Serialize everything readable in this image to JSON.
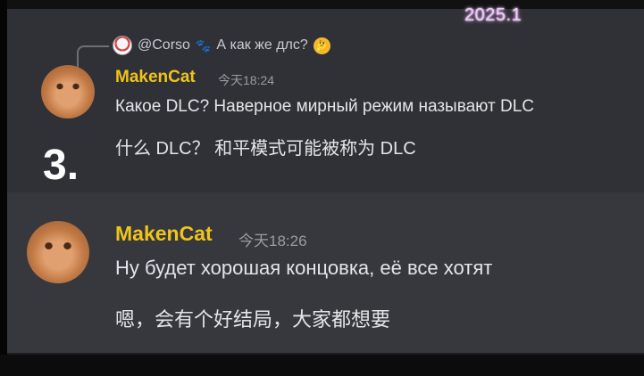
{
  "overlay": {
    "stamp": "2025.1",
    "number": "3."
  },
  "reply": {
    "author": "@Corso",
    "text": "А как же длс?",
    "paw_icon": "paw-icon",
    "emoji_icon": "thinking-face-icon"
  },
  "messages": [
    {
      "author": "MakenCat",
      "timestamp": "今天18:24",
      "lines": [
        "Какое DLC? Наверное мирный режим называют DLC",
        "什么 DLC？ 和平模式可能被称为 DLC"
      ]
    },
    {
      "author": "MakenCat",
      "timestamp": "今天18:26",
      "lines": [
        "Ну будет хорошая концовка, её все хотят",
        "嗯，会有个好结局，大家都想要"
      ]
    }
  ],
  "colors": {
    "author": "#f0c419",
    "panel_top": "#303136",
    "panel_bottom": "#36383d",
    "text": "#e4e5e8",
    "timestamp": "#9a9ca3"
  }
}
